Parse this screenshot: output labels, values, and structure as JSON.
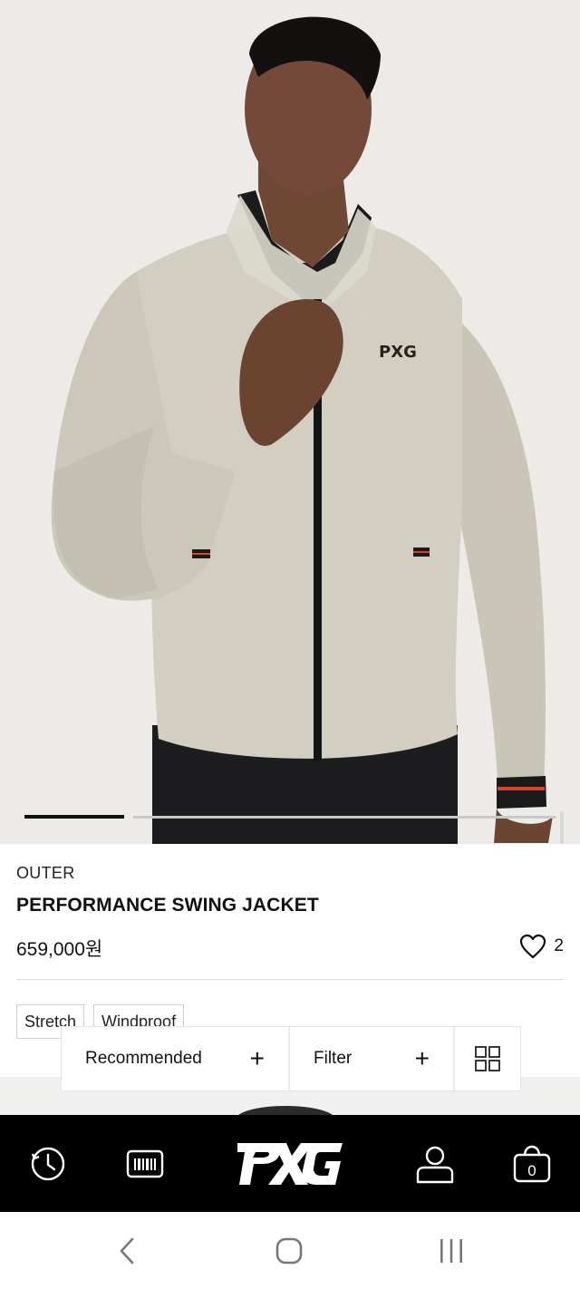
{
  "product": {
    "category": "OUTER",
    "title": "PERFORMANCE SWING JACKET",
    "price": "659,000원",
    "like_count": "2",
    "tags": [
      "Stretch",
      "Windproof"
    ],
    "image_index": 1,
    "image_count": 5
  },
  "sort_bar": {
    "recommended_label": "Recommended",
    "filter_label": "Filter"
  },
  "tab_bar": {
    "brand": "PXG",
    "cart_count": "0",
    "icons": [
      "history-icon",
      "barcode-icon",
      "pxg-logo",
      "user-icon",
      "cart-icon"
    ]
  },
  "system_nav": {
    "icons": [
      "back-icon",
      "home-icon",
      "recents-icon"
    ]
  },
  "colors": {
    "tab_bar_bg": "#000000",
    "accent_red": "#d9432b",
    "jacket": "#cfccbf"
  }
}
